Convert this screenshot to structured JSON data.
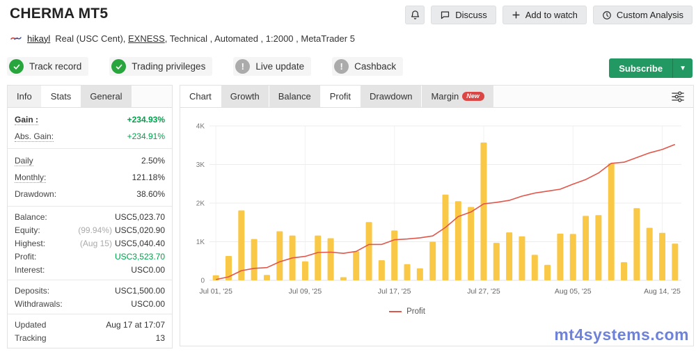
{
  "header": {
    "title": "CHERMA MT5",
    "buttons": {
      "discuss": "Discuss",
      "add_to_watch": "Add to watch",
      "custom_analysis": "Custom Analysis",
      "subscribe": "Subscribe"
    },
    "account": {
      "username": "hikayl",
      "details_pre": "Real (USC Cent),",
      "broker": "EXNESS",
      "details_post": ", Technical , Automated , 1:2000 , MetaTrader 5"
    },
    "badges": [
      {
        "label": "Track record",
        "status": "ok"
      },
      {
        "label": "Trading privileges",
        "status": "ok"
      },
      {
        "label": "Live update",
        "status": "muted"
      },
      {
        "label": "Cashback",
        "status": "muted"
      }
    ]
  },
  "stats": {
    "tabs": [
      {
        "label": "Info"
      },
      {
        "label": "Stats"
      },
      {
        "label": "General"
      }
    ],
    "gain": {
      "label": "Gain :",
      "value": "+234.93%"
    },
    "abs_gain": {
      "label": "Abs. Gain:",
      "value": "+234.91%"
    },
    "daily": {
      "label": "Daily",
      "value": "2.50%"
    },
    "monthly": {
      "label": "Monthly:",
      "value": "121.18%"
    },
    "drawdown": {
      "label": "Drawdown:",
      "value": "38.60%"
    },
    "balance": {
      "label": "Balance:",
      "value": "USC5,023.70"
    },
    "equity": {
      "label": "Equity:",
      "prefix": "(99.94%)",
      "value": "USC5,020.90"
    },
    "highest": {
      "label": "Highest:",
      "prefix": "(Aug 15)",
      "value": "USC5,040.40"
    },
    "profit": {
      "label": "Profit:",
      "value": "USC3,523.70"
    },
    "interest": {
      "label": "Interest:",
      "value": "USC0.00"
    },
    "deposits": {
      "label": "Deposits:",
      "value": "USC1,500.00"
    },
    "withdrawals": {
      "label": "Withdrawals:",
      "value": "USC0.00"
    },
    "updated": {
      "label": "Updated",
      "value": "Aug 17 at 17:07"
    },
    "tracking": {
      "label": "Tracking",
      "value": "13"
    }
  },
  "chart": {
    "tabs": [
      {
        "label": "Chart"
      },
      {
        "label": "Growth"
      },
      {
        "label": "Balance"
      },
      {
        "label": "Profit"
      },
      {
        "label": "Drawdown"
      },
      {
        "label": "Margin"
      }
    ],
    "new_badge": "New"
  },
  "chart_data": {
    "type": "bar",
    "title": "",
    "xlabel": "",
    "ylabel": "",
    "ylim": [
      0,
      4000
    ],
    "grid": true,
    "legend_position": "bottom",
    "yticks": [
      0,
      1000,
      2000,
      3000,
      4000
    ],
    "ytick_labels": [
      "0",
      "1K",
      "2K",
      "3K",
      "4K"
    ],
    "x_tick_labels": [
      "Jul 01, '25",
      "Jul 09, '25",
      "Jul 17, '25",
      "Jul 27, '25",
      "Aug 05, '25",
      "Aug 14, '25"
    ],
    "x_tick_indices": [
      0,
      7,
      14,
      21,
      28,
      35
    ],
    "bars": {
      "color": "#F9C847",
      "values": [
        130,
        630,
        1810,
        1070,
        140,
        1270,
        1160,
        490,
        1160,
        1090,
        80,
        750,
        1510,
        520,
        1290,
        420,
        310,
        1000,
        2220,
        2050,
        1900,
        3570,
        970,
        1240,
        1140,
        660,
        400,
        1210,
        1200,
        1670,
        1690,
        3030,
        470,
        1870,
        1360,
        1230,
        950
      ]
    },
    "line": {
      "name": "Profit",
      "color": "#E2564A",
      "values": [
        20,
        90,
        250,
        310,
        330,
        480,
        580,
        620,
        720,
        730,
        700,
        750,
        930,
        930,
        1050,
        1070,
        1100,
        1150,
        1370,
        1650,
        1770,
        1980,
        2020,
        2070,
        2180,
        2260,
        2310,
        2360,
        2490,
        2610,
        2780,
        3030,
        3060,
        3180,
        3300,
        3390,
        3520
      ]
    }
  },
  "watermark": "mt4systems.com",
  "colors": {
    "positive_green": "#00a14b",
    "subscribe_green": "#229862",
    "badge_ok_green": "#28a53c",
    "badge_muted_gray": "#ababab",
    "bar_yellow": "#F9C847",
    "line_red": "#E2564A",
    "new_badge_red": "#db4543",
    "watermark_blue": "#6f82d9"
  }
}
